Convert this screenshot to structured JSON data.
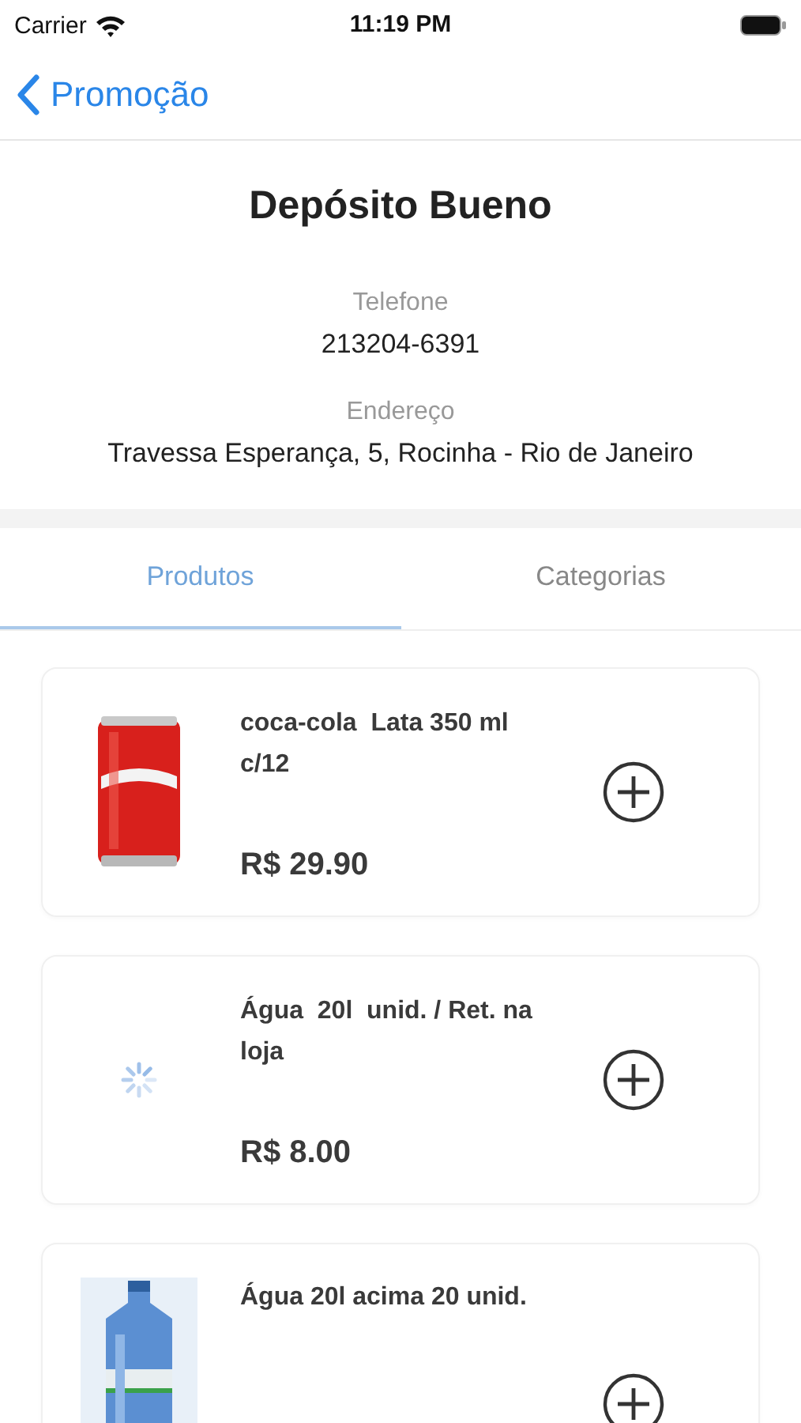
{
  "status_bar": {
    "carrier": "Carrier",
    "time": "11:19 PM"
  },
  "nav": {
    "back_label": "Promoção"
  },
  "store": {
    "name": "Depósito Bueno",
    "phone_label": "Telefone",
    "phone": "213204-6391",
    "address_label": "Endereço",
    "address": "Travessa Esperança, 5, Rocinha - Rio de Janeiro"
  },
  "tabs": [
    {
      "label": "Produtos",
      "selected": true
    },
    {
      "label": "Categorias",
      "selected": false
    }
  ],
  "products": [
    {
      "name": "coca-cola  Lata 350 ml c/12",
      "price": "R$ 29.90"
    },
    {
      "name": "Água  20l  unid. / Ret. na loja",
      "price": "R$ 8.00",
      "image": {
        "kind": "loading"
      }
    },
    {
      "name": "Água 20l acima 20 unid."
    }
  ]
}
